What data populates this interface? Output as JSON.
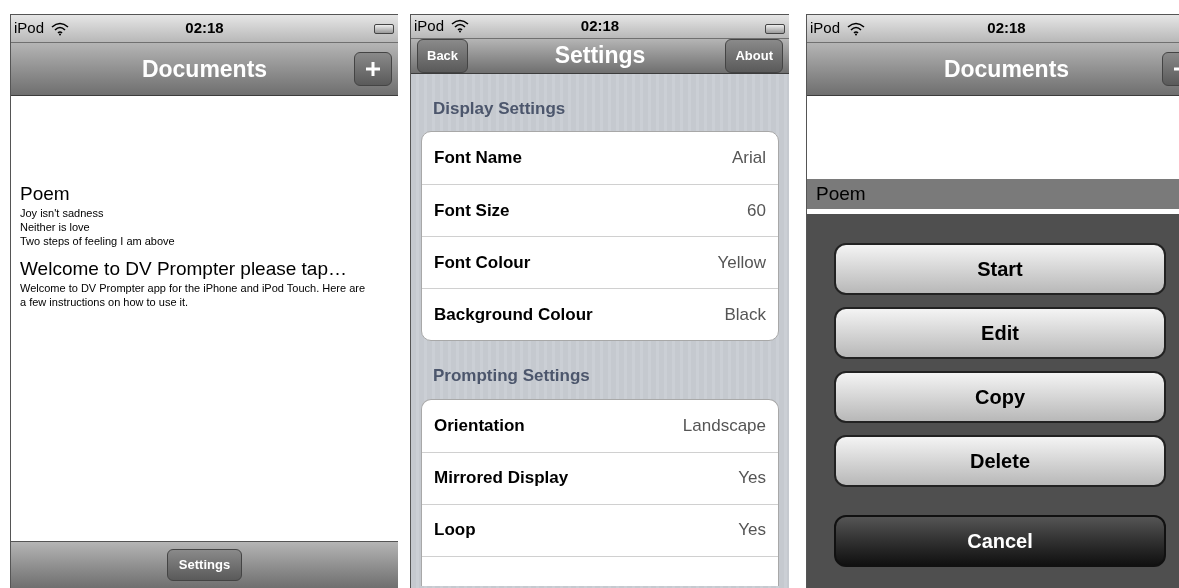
{
  "screens": [
    {
      "kind": "documents",
      "status": {
        "carrier": "iPod",
        "time": "02:18"
      },
      "title": "Documents",
      "documents": [
        {
          "title": "Poem",
          "lines": [
            "Joy isn't sadness",
            "Neither is love",
            "Two steps of feeling I am above"
          ],
          "selected": false
        },
        {
          "title": "Welcome to DV Prompter please tap…",
          "lines": [
            "Welcome to DV Prompter app for the iPhone and iPod Touch. Here are a few instructions on how to use it."
          ],
          "selected": false
        }
      ],
      "toolbar_button": "Settings"
    },
    {
      "kind": "settings",
      "status": {
        "carrier": "iPod",
        "time": "02:18"
      },
      "title": "Settings",
      "left_button": "Back",
      "right_button": "About",
      "sections": [
        {
          "header": "Display Settings",
          "rows": [
            {
              "label": "Font Name",
              "value": "Arial"
            },
            {
              "label": "Font Size",
              "value": "60"
            },
            {
              "label": "Font Colour",
              "value": "Yellow"
            },
            {
              "label": "Background Colour",
              "value": "Black"
            }
          ]
        },
        {
          "header": "Prompting Settings",
          "rows": [
            {
              "label": "Orientation",
              "value": "Landscape"
            },
            {
              "label": "Mirrored Display",
              "value": "Yes"
            },
            {
              "label": "Loop",
              "value": "Yes"
            }
          ]
        }
      ]
    },
    {
      "kind": "documents",
      "status": {
        "carrier": "iPod",
        "time": "02:18"
      },
      "title": "Documents",
      "documents": [
        {
          "title": "Poem",
          "selected": true
        }
      ],
      "actions": [
        {
          "label": "Start",
          "kind": "default"
        },
        {
          "label": "Edit",
          "kind": "default"
        },
        {
          "label": "Copy",
          "kind": "default"
        },
        {
          "label": "Delete",
          "kind": "default"
        },
        {
          "label": "Cancel",
          "kind": "cancel"
        }
      ]
    }
  ]
}
